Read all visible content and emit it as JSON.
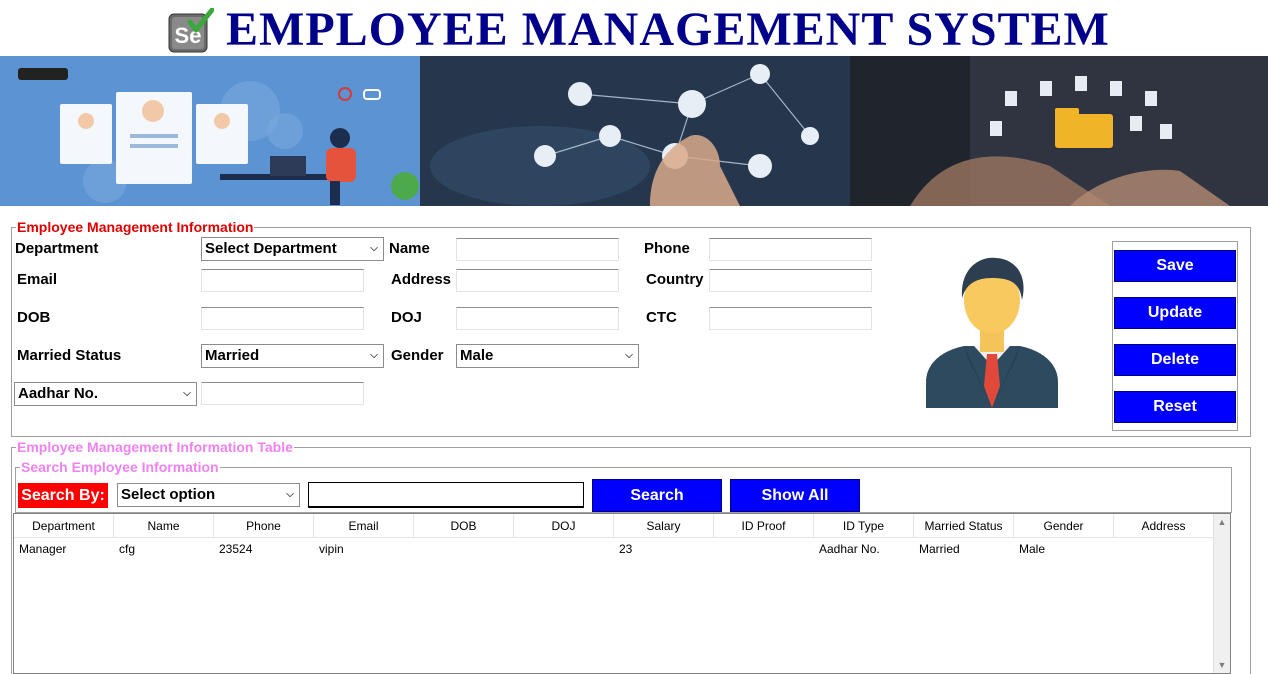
{
  "app": {
    "title": "EMPLOYEE MANAGEMENT SYSTEM",
    "logo_text": "Se"
  },
  "info_section": {
    "title": "Employee Management Information",
    "labels": {
      "department": "Department",
      "name": "Name",
      "phone": "Phone",
      "email": "Email",
      "address": "Address",
      "country": "Country",
      "dob": "DOB",
      "doj": "DOJ",
      "ctc": "CTC",
      "married_status": "Married Status",
      "gender": "Gender"
    },
    "fields": {
      "department_select": "Select Department",
      "name": "",
      "phone": "",
      "email": "",
      "address": "",
      "country": "",
      "dob": "",
      "doj": "",
      "ctc": "",
      "married_status_select": "Married",
      "gender_select": "Male",
      "id_type_select": "Aadhar No.",
      "id_number": ""
    },
    "buttons": {
      "save": "Save",
      "update": "Update",
      "delete": "Delete",
      "reset": "Reset"
    }
  },
  "table_section": {
    "title": "Employee Management Information Table",
    "search": {
      "title": "Search Employee Information",
      "search_by_label": "Search By:",
      "option_select": "Select option",
      "query": "",
      "search_button": "Search",
      "show_all_button": "Show All"
    },
    "columns": [
      "Department",
      "Name",
      "Phone",
      "Email",
      "DOB",
      "DOJ",
      "Salary",
      "ID Proof",
      "ID Type",
      "Married Status",
      "Gender",
      "Address"
    ],
    "rows": [
      [
        "Manager",
        "cfg",
        "23524",
        "vipin",
        "",
        "",
        "23",
        "",
        "Aadhar No.",
        "Married",
        "Male",
        ""
      ]
    ]
  },
  "colors": {
    "title": "#00008b",
    "section_title": "#e00000",
    "table_title": "#ee82ee",
    "button_blue": "#0000ff",
    "search_label_bg": "#ff0000"
  },
  "icons": {
    "logo": "selenium-check-logo",
    "avatar": "employee-avatar-icon",
    "dropdown": "chevron-down-icon"
  }
}
